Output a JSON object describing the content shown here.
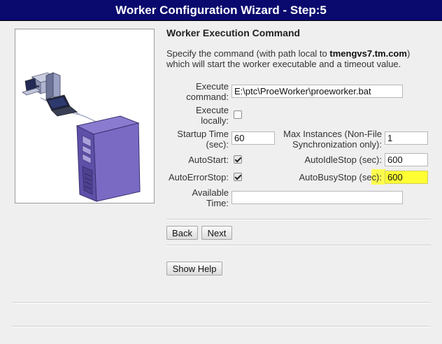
{
  "window": {
    "title": "Worker Configuration Wizard - Step:5"
  },
  "section": {
    "title": "Worker Execution Command",
    "description_pre": "Specify the command (with path local to ",
    "description_host": "tmengvs7.tm.com",
    "description_post": ") which will start the worker executable and a timeout value."
  },
  "form": {
    "execute_command_label_1": "Execute",
    "execute_command_label_2": "command:",
    "execute_command_value": "E:\\ptc\\ProeWorker\\proeworker.bat",
    "execute_locally_label_1": "Execute",
    "execute_locally_label_2": "locally:",
    "execute_locally_checked": false,
    "startup_time_label_1": "Startup Time",
    "startup_time_label_2": "(sec):",
    "startup_time_value": "60",
    "max_instances_label_1": "Max Instances (Non-File",
    "max_instances_label_2": "Synchronization only):",
    "max_instances_value": "1",
    "autostart_label": "AutoStart:",
    "autostart_checked": true,
    "autoidlestop_label": "AutoIdleStop (sec):",
    "autoidlestop_value": "600",
    "autoerrorstop_label": "AutoErrorStop:",
    "autoerrorstop_checked": true,
    "autobusystop_label": "AutoBusyStop (sec):",
    "autobusystop_value": "600",
    "available_time_label_1": "Available",
    "available_time_label_2": "Time:",
    "available_time_value": ""
  },
  "buttons": {
    "back": "Back",
    "next": "Next",
    "help": "Show Help"
  },
  "colors": {
    "title_bar": "#09096e",
    "highlight": "#ffff33",
    "background": "#efefef"
  },
  "icons": {
    "illustration": "network-computers-server-illustration"
  }
}
